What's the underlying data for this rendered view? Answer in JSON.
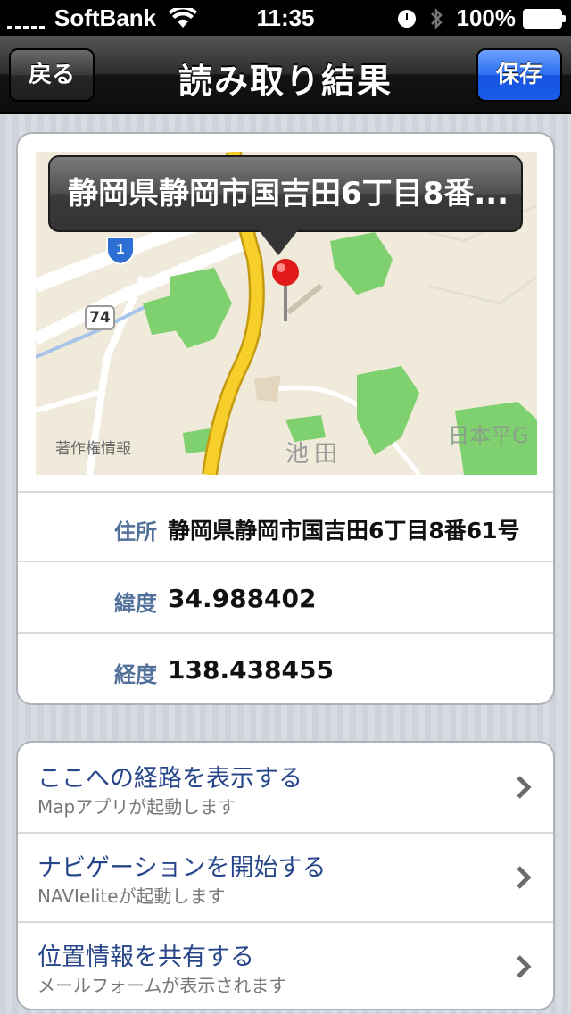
{
  "status_bar": {
    "carrier": "SoftBank",
    "time": "11:35",
    "battery": "100%"
  },
  "navbar": {
    "title": "読み取り結果",
    "back_label": "戻る",
    "save_label": "保存"
  },
  "map": {
    "callout": "静岡県静岡市国吉田6丁目8番...",
    "copyright": "著作権情報",
    "route_1": "1",
    "route_74": "74",
    "place_ikeda": "池田",
    "place_nihondaira": "日本平G"
  },
  "info": [
    {
      "label": "住所",
      "value": "静岡県静岡市国吉田6丁目8番61号"
    },
    {
      "label": "緯度",
      "value": "34.988402"
    },
    {
      "label": "経度",
      "value": "138.438455"
    }
  ],
  "actions": [
    {
      "title": "ここへの経路を表示する",
      "subtitle": "Mapアプリが起動します"
    },
    {
      "title": "ナビゲーションを開始する",
      "subtitle": "NAVIeliteが起動します"
    },
    {
      "title": "位置情報を共有する",
      "subtitle": "メールフォームが表示されます"
    }
  ],
  "colors": {
    "label_blue": "#51709a",
    "action_blue": "#27468a",
    "save_blue": "#1a5ce8"
  }
}
